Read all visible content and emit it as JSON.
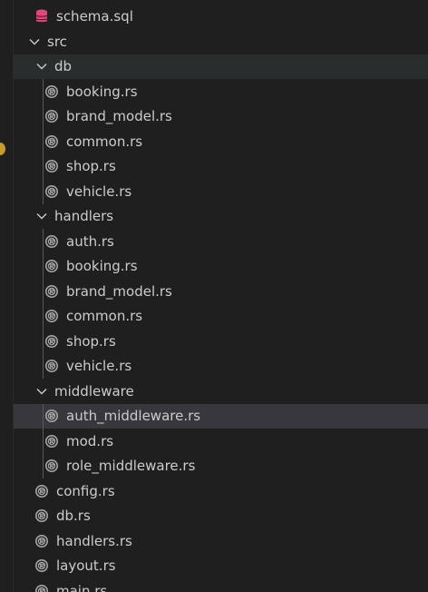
{
  "explorer": {
    "schema_file": "schema.sql",
    "src_folder": "src",
    "db_folder": "db",
    "db_files": [
      "booking.rs",
      "brand_model.rs",
      "common.rs",
      "shop.rs",
      "vehicle.rs"
    ],
    "handlers_folder": "handlers",
    "handlers_files": [
      "auth.rs",
      "booking.rs",
      "brand_model.rs",
      "common.rs",
      "shop.rs",
      "vehicle.rs"
    ],
    "middleware_folder": "middleware",
    "middleware_files": [
      "auth_middleware.rs",
      "mod.rs",
      "role_middleware.rs"
    ],
    "src_files": [
      "config.rs",
      "db.rs",
      "handlers.rs",
      "layout.rs",
      "main.rs"
    ]
  },
  "colors": {
    "background": "#1f1f1f",
    "hover": "#2a2d2e",
    "selected": "#37373d",
    "text": "#cccccc",
    "icon_rust": "#a5a5a5",
    "icon_database": "#e0457b",
    "warning": "#c89a2a"
  },
  "icons": {
    "folder_expanded": "chevron-down-icon",
    "rust_file": "rust-file-icon",
    "sql_file": "database-icon"
  }
}
